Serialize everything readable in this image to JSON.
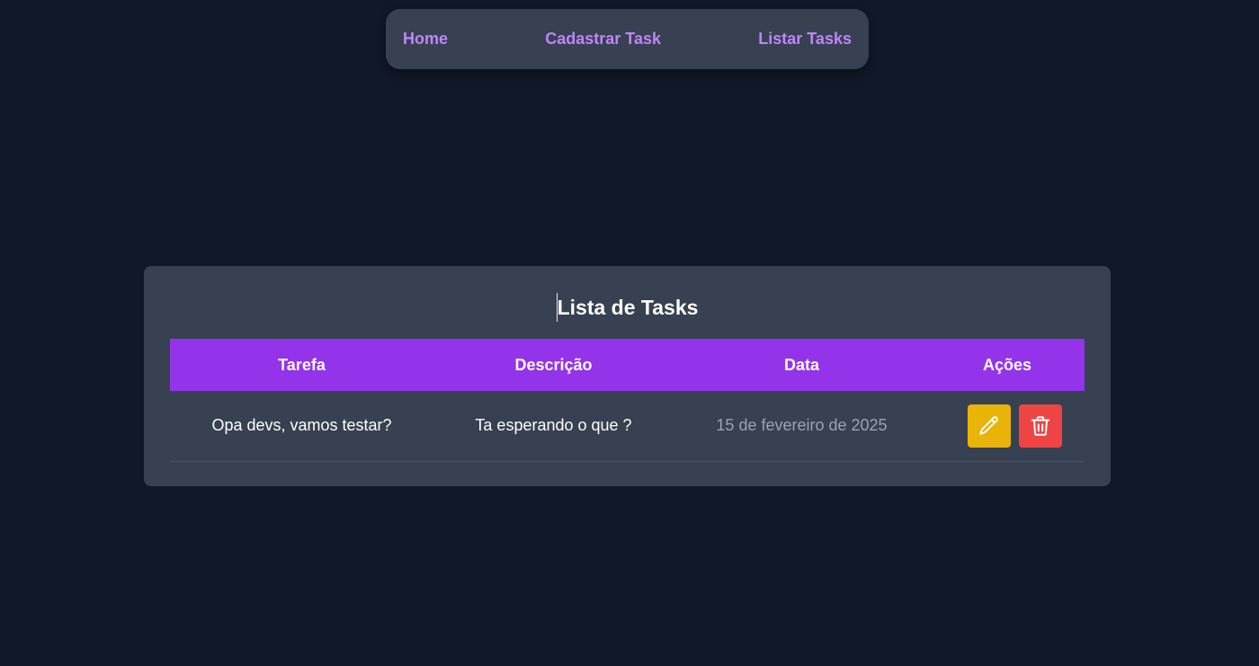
{
  "nav": {
    "items": [
      {
        "label": "Home"
      },
      {
        "label": "Cadastrar Task"
      },
      {
        "label": "Listar Tasks"
      }
    ]
  },
  "card": {
    "title": "Lista de Tasks"
  },
  "table": {
    "headers": [
      "Tarefa",
      "Descrição",
      "Data",
      "Ações"
    ],
    "rows": [
      {
        "tarefa": "Opa devs, vamos testar?",
        "descricao": "Ta esperando o que ?",
        "data": "15 de fevereiro de 2025",
        "actions": [
          {
            "icon": "pencil-icon"
          },
          {
            "icon": "trash-icon"
          }
        ]
      }
    ]
  },
  "colors": {
    "background": "#111827",
    "panel": "#374151",
    "accent": "#9333ea",
    "nav_link": "#c084fc",
    "edit": "#eab308",
    "delete": "#ef4444"
  }
}
